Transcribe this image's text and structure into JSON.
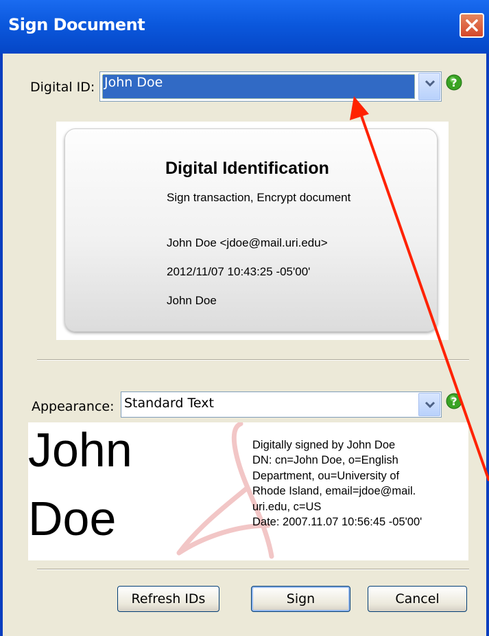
{
  "window": {
    "title": "Sign Document"
  },
  "digital_id": {
    "label": "Digital ID:",
    "value": "John Doe"
  },
  "card": {
    "title": "Digital Identification",
    "usage": "Sign transaction, Encrypt document",
    "email_line": "John Doe <jdoe@mail.uri.edu>",
    "date": "2012/11/07 10:43:25 -05'00'",
    "name": "John Doe"
  },
  "appearance": {
    "label": "Appearance:",
    "value": "Standard Text"
  },
  "preview": {
    "first_name": "John",
    "last_name": "Doe",
    "details": [
      "Digitally signed by John Doe",
      "DN: cn=John Doe, o=English",
      "Department, ou=University of",
      "Rhode Island, email=jdoe@mail.",
      "uri.edu, c=US",
      "Date: 2007.11.07 10:56:45 -05'00'"
    ]
  },
  "buttons": {
    "refresh": "Refresh IDs",
    "sign": "Sign",
    "cancel": "Cancel"
  },
  "icons": {
    "close": "close-icon",
    "help": "help-icon",
    "dropdown": "chevron-down-icon",
    "logo": "adobe-logo-watermark"
  },
  "colors": {
    "titlebar": "#0b58dd",
    "selection": "#316ac5",
    "annotation_arrow": "#ff2200",
    "help_green": "#3aa324"
  }
}
